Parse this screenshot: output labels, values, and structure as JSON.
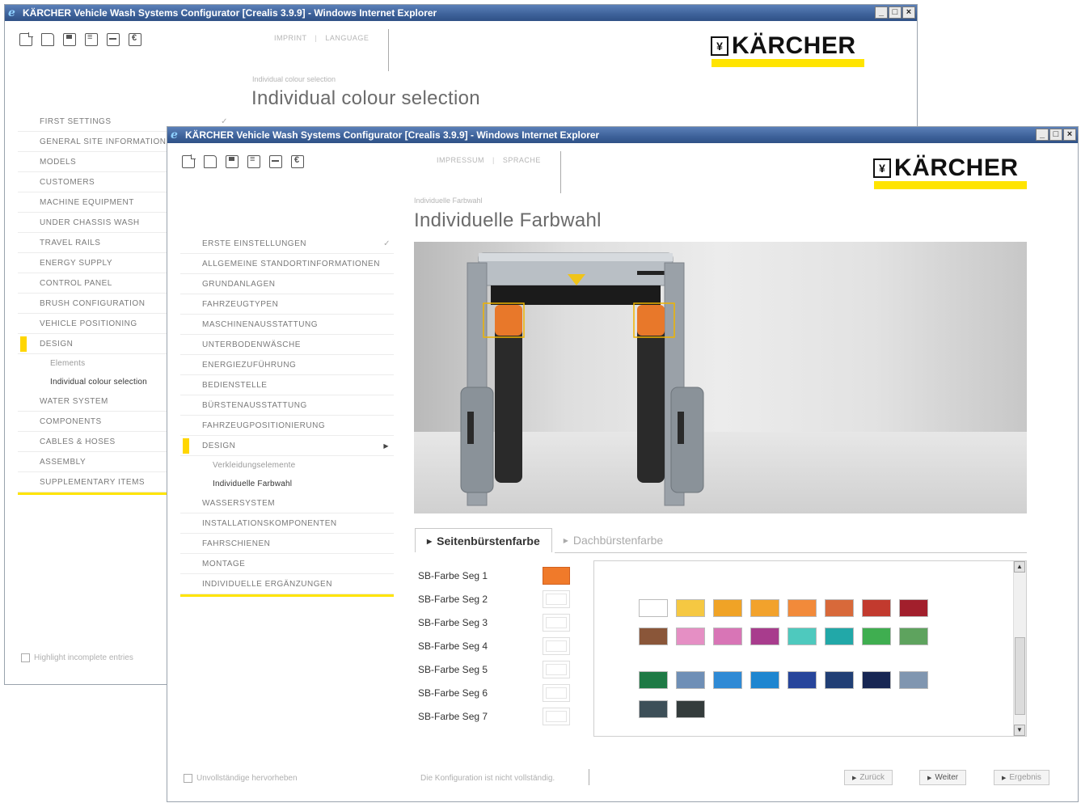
{
  "back_window": {
    "title": "KÄRCHER Vehicle Wash Systems Configurator [Crealis 3.9.9] - Windows Internet Explorer",
    "win_buttons": [
      "_",
      "□",
      "×"
    ],
    "topnav": [
      "IMPRINT",
      "LANGUAGE"
    ],
    "breadcrumb": "Individual colour selection",
    "page_title": "Individual colour selection",
    "logo_text": "KÄRCHER",
    "nav": [
      {
        "label": "FIRST SETTINGS",
        "done": true
      },
      {
        "label": "GENERAL SITE INFORMATION"
      },
      {
        "label": "MODELS"
      },
      {
        "label": "CUSTOMERS"
      },
      {
        "label": "MACHINE EQUIPMENT"
      },
      {
        "label": "UNDER CHASSIS WASH"
      },
      {
        "label": "TRAVEL RAILS"
      },
      {
        "label": "ENERGY SUPPLY"
      },
      {
        "label": "CONTROL PANEL"
      },
      {
        "label": "BRUSH CONFIGURATION"
      },
      {
        "label": "VEHICLE POSITIONING"
      },
      {
        "label": "DESIGN",
        "active": true
      },
      {
        "label": "Elements",
        "sub": true
      },
      {
        "label": "Individual colour selection",
        "sub": true,
        "active": true
      },
      {
        "label": "WATER SYSTEM"
      },
      {
        "label": "COMPONENTS"
      },
      {
        "label": "CABLES & HOSES"
      },
      {
        "label": "ASSEMBLY"
      },
      {
        "label": "SUPPLEMENTARY ITEMS"
      }
    ],
    "highlight_label": "Highlight incomplete entries"
  },
  "front_window": {
    "title": "KÄRCHER Vehicle Wash Systems Configurator [Crealis 3.9.9] - Windows Internet Explorer",
    "win_buttons": [
      "_",
      "□",
      "×"
    ],
    "topnav": [
      "IMPRESSUM",
      "SPRACHE"
    ],
    "breadcrumb": "Individuelle Farbwahl",
    "page_title": "Individuelle Farbwahl",
    "logo_text": "KÄRCHER",
    "nav": [
      {
        "label": "ERSTE EINSTELLUNGEN",
        "done": true
      },
      {
        "label": "ALLGEMEINE STANDORTINFORMATIONEN"
      },
      {
        "label": "GRUNDANLAGEN"
      },
      {
        "label": "FAHRZEUGTYPEN"
      },
      {
        "label": "MASCHINENAUSSTATTUNG"
      },
      {
        "label": "UNTERBODENWÄSCHE"
      },
      {
        "label": "ENERGIEZUFÜHRUNG"
      },
      {
        "label": "BEDIENSTELLE"
      },
      {
        "label": "BÜRSTENAUSSTATTUNG"
      },
      {
        "label": "FAHRZEUGPOSITIONIERUNG"
      },
      {
        "label": "DESIGN",
        "active": true,
        "expanded": true
      },
      {
        "label": "Verkleidungselemente",
        "sub": true
      },
      {
        "label": "Individuelle Farbwahl",
        "sub": true,
        "active": true
      },
      {
        "label": "WASSERSYSTEM"
      },
      {
        "label": "INSTALLATIONSKOMPONENTEN"
      },
      {
        "label": "FAHRSCHIENEN"
      },
      {
        "label": "MONTAGE"
      },
      {
        "label": "INDIVIDUELLE ERGÄNZUNGEN"
      }
    ],
    "tabs": [
      "Seitenbürstenfarbe",
      "Dachbürstenfarbe"
    ],
    "active_tab": 0,
    "segments": [
      {
        "label": "SB-Farbe Seg 1",
        "color": "#f07a2a"
      },
      {
        "label": "SB-Farbe Seg 2"
      },
      {
        "label": "SB-Farbe Seg 3"
      },
      {
        "label": "SB-Farbe Seg 4"
      },
      {
        "label": "SB-Farbe Seg 5"
      },
      {
        "label": "SB-Farbe Seg 6"
      },
      {
        "label": "SB-Farbe Seg 7"
      }
    ],
    "palette_rows": [
      [
        "#ffffff",
        "#f5c842",
        "#f0a326",
        "#f2a22c",
        "#f28a3a",
        "#d8693a",
        "#c23a2e",
        "#a21f2c"
      ],
      [
        "#8a5639",
        "#e58fc4",
        "#d875b6",
        "#a83c8d",
        "#4ec9be",
        "#22a8a8",
        "#3fae50",
        "#5ea35e"
      ],
      [
        "#1e7a45",
        "#6f8fb6",
        "#2f8ad5",
        "#1e86d0",
        "#27459b",
        "#213f75",
        "#172653",
        "#8096b0"
      ],
      [
        "#3d4f58",
        "#343c3c"
      ]
    ],
    "highlight_label": "Unvollständige hervorheben",
    "footer_message": "Die Konfiguration ist nicht vollständig.",
    "buttons": {
      "back": "Zurück",
      "next": "Weiter",
      "result": "Ergebnis"
    }
  }
}
